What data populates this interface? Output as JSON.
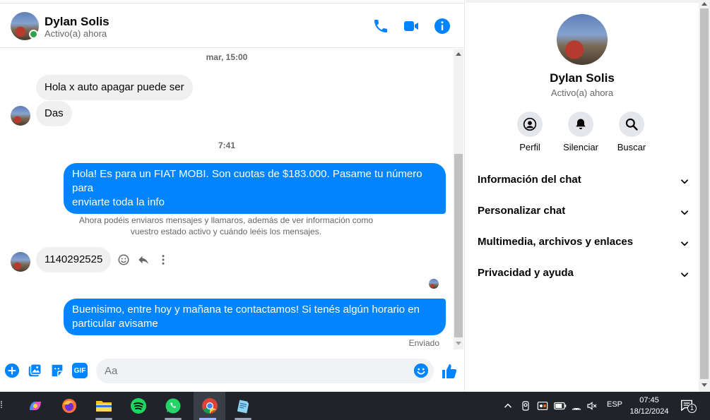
{
  "contact": {
    "name": "Dylan Solis",
    "status": "Activo(a) ahora"
  },
  "messages": {
    "time_1": "mar, 15:00",
    "in_1": "Hola x auto apagar puede ser",
    "in_2": "Das",
    "time_2": "7:41",
    "out_1_line1": "Hola! Es para un FIAT MOBI. Son cuotas de $183.000. Pasame tu número para",
    "out_1_line2": "enviarte toda la info",
    "system_note_line1": "Ahora podéis enviaros mensajes y llamaros, además de ver información como",
    "system_note_line2": "vuestro estado activo y cuándo leéis los mensajes.",
    "in_3": "1140292525",
    "out_2_line1": "Buenisimo, entre hoy y mañana te contactamos! Si tenés algún horario en",
    "out_2_line2": "particular avisame",
    "delivery_status": "Enviado"
  },
  "composer": {
    "placeholder": "Aa",
    "gif_label": "GIF"
  },
  "panel": {
    "actions": [
      {
        "label": "Perfil",
        "icon": "profile-icon"
      },
      {
        "label": "Silenciar",
        "icon": "bell-icon"
      },
      {
        "label": "Buscar",
        "icon": "search-icon"
      }
    ],
    "sections": [
      "Información del chat",
      "Personalizar chat",
      "Multimedia, archivos y enlaces",
      "Privacidad y ayuda"
    ]
  },
  "taskbar": {
    "language": "ESP",
    "time": "07:45",
    "date": "18/12/2024",
    "notification_count": "1",
    "apps": [
      "copilot",
      "firefox",
      "file-explorer",
      "spotify",
      "whatsapp",
      "chrome",
      "notepad"
    ]
  },
  "colors": {
    "accent": "#0084ff",
    "online": "#31a24c",
    "incoming_bubble": "#f0f0f0"
  }
}
